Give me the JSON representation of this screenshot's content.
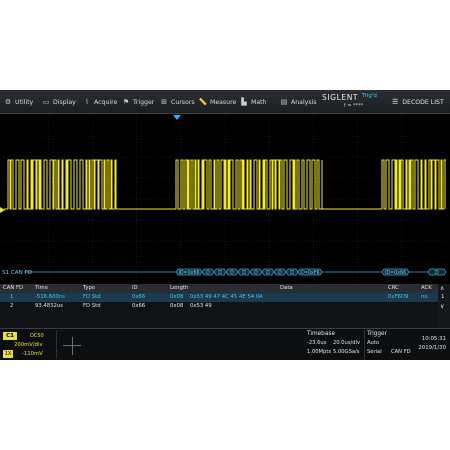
{
  "menu": {
    "items": [
      {
        "label": "Utility",
        "icon": "utility-icon"
      },
      {
        "label": "Display",
        "icon": "display-icon"
      },
      {
        "label": "Acquire",
        "icon": "acquire-icon"
      },
      {
        "label": "Trigger",
        "icon": "trigger-icon"
      },
      {
        "label": "Cursors",
        "icon": "cursors-icon"
      },
      {
        "label": "Measure",
        "icon": "measure-icon"
      },
      {
        "label": "Math",
        "icon": "math-icon"
      },
      {
        "label": "Analysis",
        "icon": "analysis-icon"
      }
    ],
    "brand": "SIGLENT",
    "brand_sub": "f = ****",
    "trigger_state": "Trig'd",
    "decode_list": "DECODE LIST"
  },
  "bus": {
    "label": "S1 CAN FD",
    "frame_labels": [
      "ID=0x66",
      "D",
      "D",
      "D",
      "D",
      "D",
      "D",
      "D",
      "D",
      "C=0xF6",
      "ID=0x66",
      "D"
    ]
  },
  "table": {
    "headers": [
      "CAN FD",
      "Time",
      "Type",
      "ID",
      "Length",
      "Data",
      "CRC",
      "ACK"
    ],
    "rows": [
      {
        "no": "1",
        "time": "-516.600ns",
        "type": "FD Std",
        "id": "0x66",
        "length": "0x08",
        "data": "0x53 49 47 4C 45 4E 54 0A",
        "crc": "0xF6D9",
        "ack": "no"
      },
      {
        "no": "2",
        "time": "93.4832us",
        "type": "FD Std",
        "id": "0x66",
        "length": "0x08",
        "data": "0x53 49",
        "crc": "",
        "ack": ""
      }
    ],
    "page_up": "∧",
    "page": "1",
    "page_down": "∨"
  },
  "channel": {
    "tag": "C1",
    "coupling": "DC50",
    "scale": "200mV/div",
    "probe": "1X",
    "offset": "-110mV",
    "color": "#e8e040"
  },
  "timebase": {
    "title": "Timebase",
    "delay": "-23.6us",
    "scale": "20.0us/div",
    "memory": "1.00Mpts",
    "rate": "5.00GSa/s"
  },
  "trigger": {
    "title": "Trigger",
    "mode": "Auto",
    "source": "Serial",
    "protocol": "CAN FD"
  },
  "clock": {
    "time": "10:05:31",
    "date": "2019/1/30"
  },
  "colors": {
    "trace": "#f2ea2c",
    "bus": "#3aa8d8",
    "accent": "#35d1ff"
  }
}
